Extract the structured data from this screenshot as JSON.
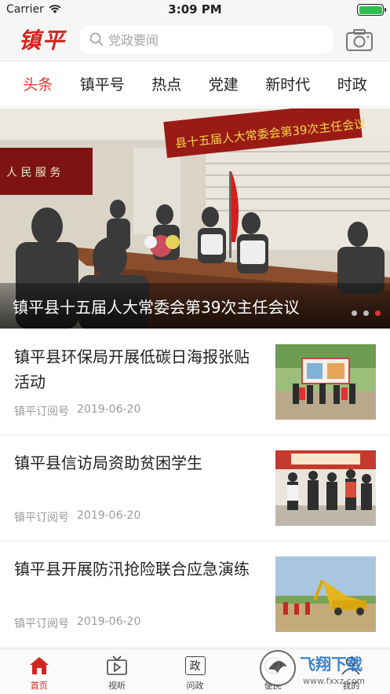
{
  "status_bar": {
    "carrier": "Carrier",
    "time": "3:09 PM",
    "battery_level": 1.0
  },
  "header": {
    "logo": "镇平",
    "search_placeholder": "党政要闻"
  },
  "tabs": [
    {
      "label": "头条",
      "active": true
    },
    {
      "label": "镇平号",
      "active": false
    },
    {
      "label": "热点",
      "active": false
    },
    {
      "label": "党建",
      "active": false
    },
    {
      "label": "新时代",
      "active": false
    },
    {
      "label": "时政",
      "active": false
    }
  ],
  "banner": {
    "title": "镇平县十五届人大常委会第39次主任会议",
    "photo_sign": "县十五届人大常委会第39次主任会议",
    "photo_wall_text": "人 民 服 务",
    "slide_count": 3,
    "active_slide": 3
  },
  "news": [
    {
      "title": "镇平县环保局开展低碳日海报张贴活动",
      "source": "镇平订阅号",
      "date": "2019-06-20"
    },
    {
      "title": "镇平县信访局资助贫困学生",
      "source": "镇平订阅号",
      "date": "2019-06-20"
    },
    {
      "title": "镇平县开展防汛抢险联合应急演练",
      "source": "镇平订阅号",
      "date": "2019-06-20"
    }
  ],
  "tabbar": [
    {
      "label": "首页",
      "icon": "home-icon",
      "active": true
    },
    {
      "label": "视听",
      "icon": "tv-icon",
      "active": false
    },
    {
      "label": "问政",
      "icon": "zheng-icon",
      "glyph": "政",
      "active": false
    },
    {
      "label": "便民",
      "icon": "service-icon",
      "active": false
    },
    {
      "label": "我的",
      "icon": "user-icon",
      "active": false
    }
  ],
  "watermark": "飞翔下载 www.fxxz.com",
  "colors": {
    "accent": "#e23a2f",
    "logo": "#d0261f",
    "muted": "#9b9b9b"
  }
}
